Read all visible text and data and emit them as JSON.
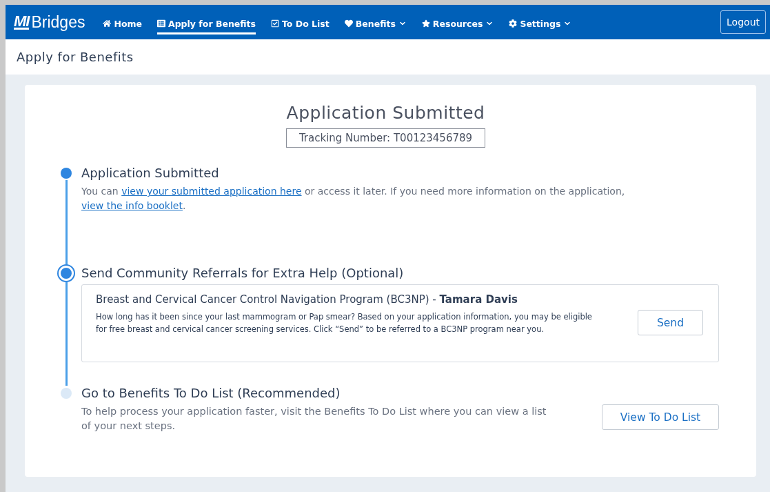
{
  "nav": {
    "logo": {
      "mark": "MI",
      "name": "Bridges"
    },
    "items": [
      {
        "label": "Home",
        "selected": false,
        "dropdown": false
      },
      {
        "label": "Apply for Benefits",
        "selected": true,
        "dropdown": false
      },
      {
        "label": "To Do List",
        "selected": false,
        "dropdown": false
      },
      {
        "label": "Benefits",
        "selected": false,
        "dropdown": true
      },
      {
        "label": "Resources",
        "selected": false,
        "dropdown": true
      },
      {
        "label": "Settings",
        "selected": false,
        "dropdown": true
      }
    ],
    "logout": "Logout"
  },
  "page_title": "Apply for Benefits",
  "card": {
    "title": "Application Submitted",
    "tracking": "Tracking Number: T00123456789",
    "steps": [
      {
        "kind": "done",
        "title": "Application Submitted",
        "description": [
          {
            "kind": "text",
            "text": "You can "
          },
          {
            "kind": "link",
            "text": "view your submitted application here"
          },
          {
            "kind": "text",
            "text": " or access it later. If you need more information on the application, "
          },
          {
            "kind": "link",
            "text": "view the info booklet"
          },
          {
            "kind": "text",
            "text": "."
          }
        ]
      },
      {
        "kind": "current",
        "title": "Send Community Referrals for Extra Help (Optional)",
        "referral": {
          "title": "Breast and Cervical Cancer Control Navigation Program (BC3NP) - **Tamara Davis**",
          "text": "How long has it been since your last mammogram or Pap smear? Based on your application information, you may be eligible for free breast and cervical cancer screening services. Click “Send” to be referred to a BC3NP program near you.",
          "button": "Send"
        }
      },
      {
        "kind": "upcoming",
        "title": "Go to Benefits To Do List (Recommended)",
        "text": "To help process your application faster, visit the Benefits To Do List where you can view a list of your next steps.",
        "button": "View To Do List"
      }
    ]
  }
}
